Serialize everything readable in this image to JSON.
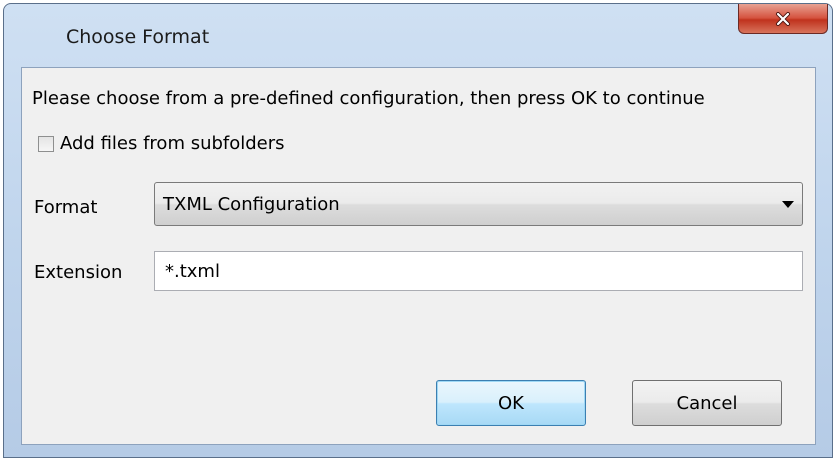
{
  "window": {
    "title": "Choose Format",
    "close_icon": "close-icon"
  },
  "dialog": {
    "instruction": "Please choose from a pre-defined configuration, then press OK to continue",
    "add_subfolders": {
      "label": "Add files from subfolders",
      "checked": false
    },
    "format": {
      "label": "Format",
      "selected": "TXML Configuration"
    },
    "extension": {
      "label": "Extension",
      "value": "*.txml"
    },
    "buttons": {
      "ok": "OK",
      "cancel": "Cancel"
    }
  }
}
